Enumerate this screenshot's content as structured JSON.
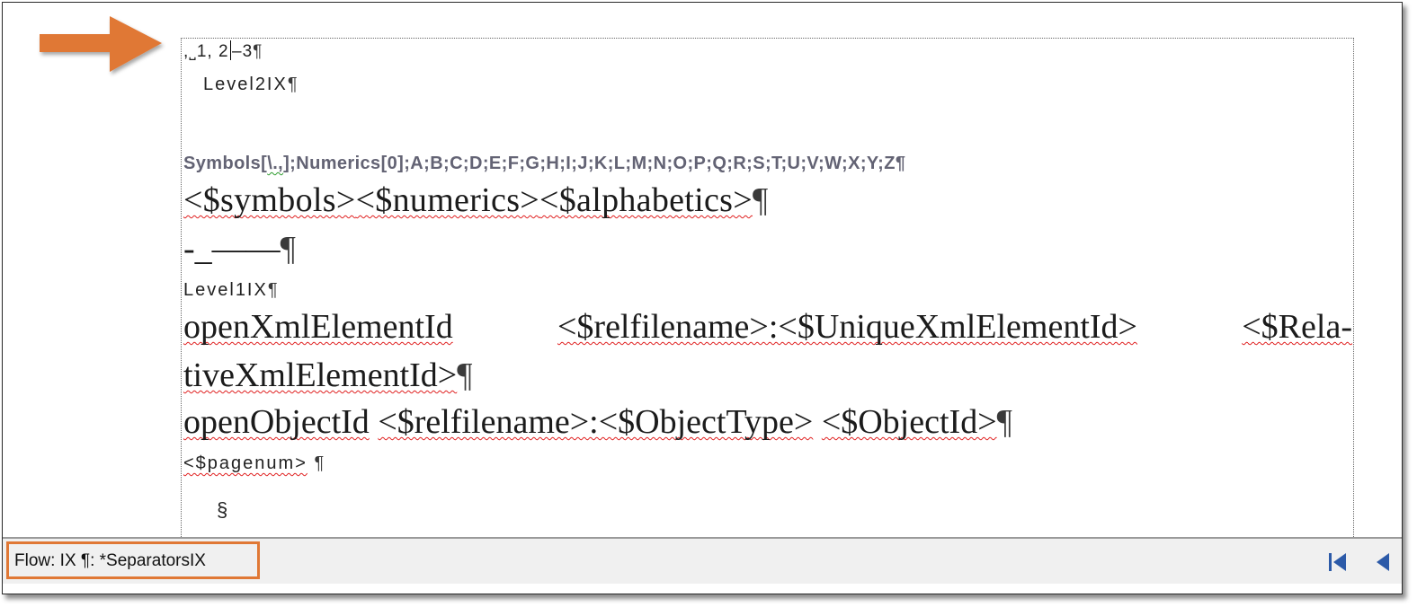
{
  "editor": {
    "line_numbers": {
      "text": ",˽1, 2",
      "after_caret": "–3",
      "pilcrow": "¶"
    },
    "level2": {
      "text": "Level2IX",
      "pilcrow": "¶"
    },
    "symbols_line": {
      "prefix": "Symbols[",
      "squiggle": "\\.,",
      "suffix": "];Numerics[0];A;B;C;D;E;F;G;H;I;J;K;L;M;N;O;P;Q;R;S;T;U;V;W;X;Y;Z",
      "pilcrow": "¶"
    },
    "placeholders_line": {
      "a": "<$symbols>",
      "b": "<$numerics>",
      "c": "<$alphabetics>",
      "pilcrow": "¶"
    },
    "dash_line": {
      "text": "-_——",
      "pilcrow": "¶"
    },
    "level1": {
      "text": "Level1IX",
      "pilcrow": "¶"
    },
    "xml_line1": {
      "a": "openXmlElementId",
      "b": "<$relfilename>:<$UniqueXmlElementId>",
      "c": "<$Rela-"
    },
    "xml_line2": {
      "text": "tiveXmlElementId>",
      "pilcrow": "¶"
    },
    "object_line": {
      "a": "openObjectId",
      "b": "<$relfilename>:<$ObjectType>",
      "c": "<$ObjectId>",
      "pilcrow": "¶"
    },
    "pagenum": {
      "text": "<$pagenum>",
      "pilcrow": "¶"
    },
    "section_mark": "§"
  },
  "statusbar": {
    "flow_text": "Flow: IX  ¶: *SeparatorsIX"
  },
  "colors": {
    "annotation": "#e07835",
    "spell_squiggle": "#e02020",
    "grammar_squiggle": "#2a9a2a",
    "nav_icons": "#2c5aa8"
  },
  "icons": [
    "arrow-annotation-icon",
    "first-page-icon",
    "previous-page-icon"
  ]
}
